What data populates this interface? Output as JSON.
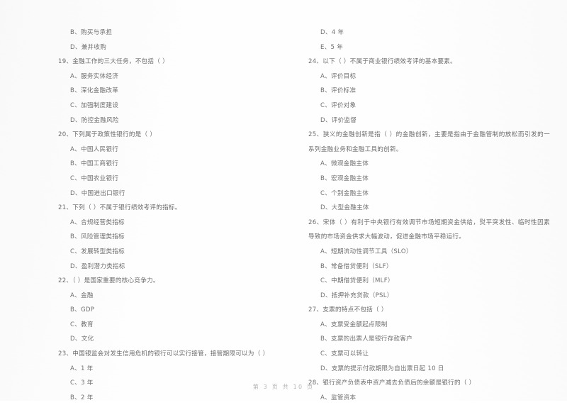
{
  "document": {
    "type": "exam-paper",
    "language": "zh-CN",
    "footer": "第 3 页 共 10 页"
  },
  "left_column": [
    {
      "kind": "option",
      "label": "B、购买与承担"
    },
    {
      "kind": "option",
      "label": "D、兼并收购"
    },
    {
      "kind": "question",
      "number": "19",
      "stem": "19、金融工作的三大任务，不包括（        ）",
      "options": [
        "A、服务实体经济",
        "B、深化金融改革",
        "C、加强制度建设",
        "D、防控金融风险"
      ]
    },
    {
      "kind": "question",
      "number": "20",
      "stem": "20、下列属于政策性银行的是（        ）",
      "options": [
        "A、中国人民银行",
        "B、中国工商银行",
        "C、中国农业银行",
        "D、中国进出口银行"
      ]
    },
    {
      "kind": "question",
      "number": "21",
      "stem": "21、下列（        ）不属于银行绩效考评的指标。",
      "options": [
        "A、合规经营类指标",
        "B、风险管理类指标",
        "C、发展转型类指标",
        "D、盈利潜力类指标"
      ]
    },
    {
      "kind": "question",
      "number": "22",
      "stem": "22、（        ）是国家重要的核心竞争力。",
      "options": [
        "A、金融",
        "B、GDP",
        "C、教育",
        "D、文化"
      ]
    },
    {
      "kind": "question",
      "number": "23",
      "stem": "23、中国银监会对发生信用危机的银行可以实行接管，接管期限可以为（        ）",
      "options": [
        "A、1 年",
        "C、3 年",
        "B、2 年"
      ]
    }
  ],
  "right_column": [
    {
      "kind": "option",
      "label": "D、4 年"
    },
    {
      "kind": "option",
      "label": "E、5 年"
    },
    {
      "kind": "question",
      "number": "24",
      "stem": "24、以下（        ）不属于商业银行绩效考评的基本要素。",
      "options": [
        "A、评价目标",
        "B、评价标准",
        "C、评价对象",
        "D、评价监督"
      ]
    },
    {
      "kind": "question",
      "number": "25",
      "stem": "25、狭义的金融创新是指（        ）的金融创新，主要是指由于金融管制的放松而引发的一系列金融业务和金融工具的创新。",
      "options": [
        "A、微观金融主体",
        "B、宏观金融主体",
        "C、个别金融主体",
        "D、大型金融主体"
      ]
    },
    {
      "kind": "question",
      "number": "26",
      "stem": "26、宋体（        ）有利于中央银行有效调节市场短期资金供给，熨平突发性、临时性因素导致的市场资金供求大幅波动，促进金融市场平稳运行。",
      "options": [
        "A、短期流动性调节工具（SLO）",
        "B、常备借贷便利（SLF）",
        "C、中期借贷便利（MLF）",
        "D、抵押补充贷款（PSL）"
      ]
    },
    {
      "kind": "question",
      "number": "27",
      "stem": "27、支票的特点不包括（        ）",
      "options": [
        "A、支票受金额起点限制",
        "B、支票的出票人是银行存款客户",
        "C、支票可以转让",
        "D、支票的提示付款期限为自出票日起 10 日"
      ]
    },
    {
      "kind": "question",
      "number": "28",
      "stem": "28、银行资产负债表中资产减去负债后的余额是银行的（        ）",
      "options": [
        "A、监管资本"
      ]
    }
  ]
}
